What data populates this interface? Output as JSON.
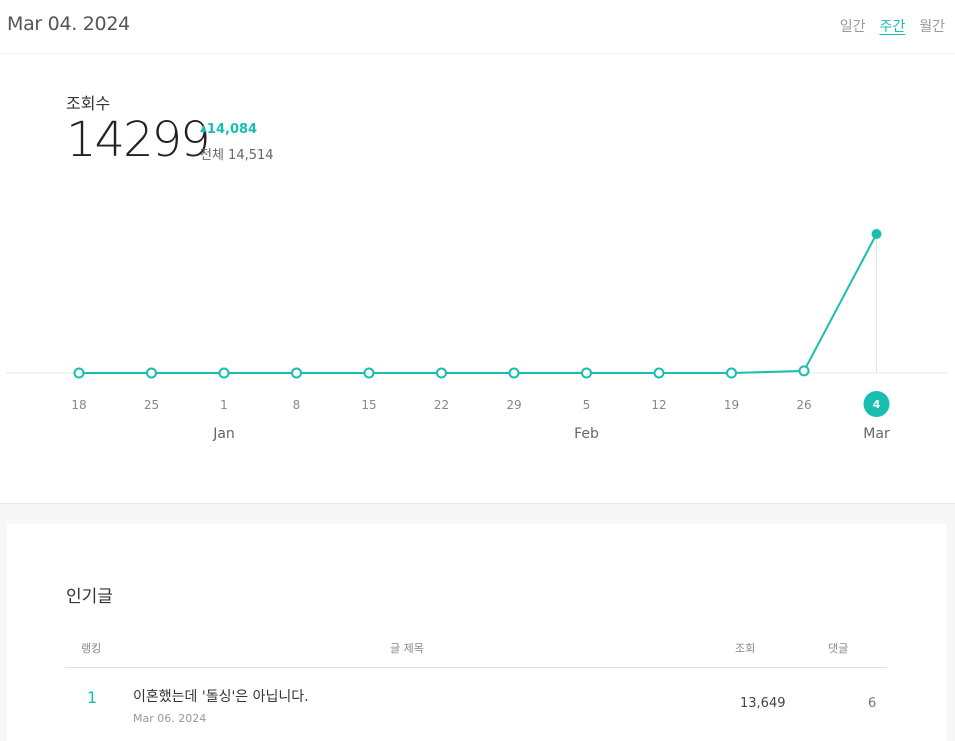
{
  "header": {
    "date": "Mar 04. 2024",
    "tabs": [
      {
        "label": "일간",
        "active": false
      },
      {
        "label": "주간",
        "active": true
      },
      {
        "label": "월간",
        "active": false
      }
    ]
  },
  "stats": {
    "label": "조회수",
    "value": "14299",
    "change": "14,084",
    "total": "전체 14,514"
  },
  "chart_data": {
    "type": "line",
    "x": [
      "18",
      "25",
      "1",
      "8",
      "15",
      "22",
      "29",
      "5",
      "12",
      "19",
      "26",
      "4"
    ],
    "months": [
      {
        "label": "Jan",
        "at": "1"
      },
      {
        "label": "Feb",
        "at": "5"
      },
      {
        "label": "Mar",
        "at": "4"
      }
    ],
    "values": [
      0,
      0,
      0,
      0,
      0,
      0,
      0,
      0,
      0,
      0,
      215,
      14299
    ],
    "highlight_index": 11,
    "color": "#18bfb0"
  },
  "popular": {
    "title": "인기글",
    "columns": {
      "rank": "랭킹",
      "title": "글 제목",
      "views": "조회",
      "comments": "댓글"
    },
    "rows": [
      {
        "rank": "1",
        "title": "이혼했는데 '돌싱'은 아닙니다.",
        "date": "Mar 06. 2024",
        "views": "13,649",
        "comments": "6"
      }
    ]
  }
}
